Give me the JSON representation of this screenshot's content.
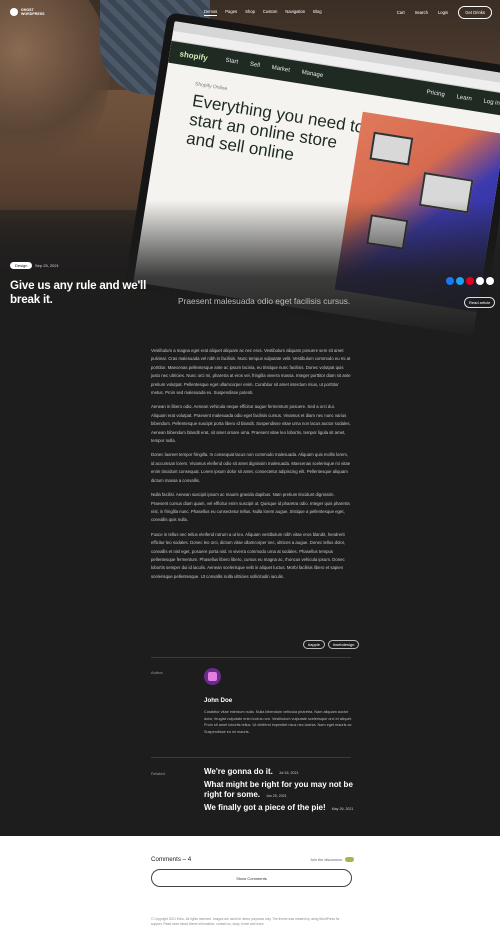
{
  "nav": {
    "logo_text": "GHOST WORDPRESS",
    "menu": [
      "Demos",
      "Pages",
      "Shop",
      "Custom",
      "Navigation",
      "Blog"
    ],
    "right": [
      "Cart",
      "Search",
      "Login"
    ],
    "cta": "Get Drinks"
  },
  "hero": {
    "category": "Design",
    "date": "Sep 25, 2021",
    "title": "Give us any rule and we'll break it.",
    "subtitle": "Praesent malesuada odio eget facilisis cursus.",
    "read_button": "Read article",
    "share_colors": [
      "#1877f2",
      "#1da1f2",
      "#e60023",
      "#ffffff",
      "#ffffff"
    ],
    "screen": {
      "logo": "shopify",
      "nav": [
        "Start",
        "Sell",
        "Market",
        "Manage"
      ],
      "nav_right": [
        "Pricing",
        "Learn",
        "Log in"
      ],
      "small": "Shopify Online",
      "headline": "Everything you need to start an online store and sell online"
    }
  },
  "article": {
    "paragraphs": [
      "Vestibulum a magna eget erat aliquet aliquam ac nec eros. Vestibulum aliquam posuere sem sit amet pulvinar. Cras malesuada vel nibh in facilisis. Nunc tempus vulputate velit. Vestibulum commodo eu mi at porttitor. Maecenas pellentesque ante ac ipsum lacinia, eu tristique nunc facilisis. Donec volutpat quis justo nec ultricies. Nunc orci mi, pharetra at eros vel, fringilla viverra massa. Integer porttitor diam sit ante pretium volutpat. Pellentesque eget ullamcorper enim. Curabitur sit amet interdum risus, ut porttitor metus. Proin sed malesuada ex. Suspendisse potenti.",
      "Aenean in libero odio. Aenean vehicula neque efficitur augue fermentum posuere. Sed a orci dui. Aliquam erat volutpat. Praesent malesuada odio eget facilisis cursus. Vivamus et diam nec nunc varius bibendum. Pellentesque suscipit porta libero id blandit. Suspendisse vitae urna non lacus auctor sodales. Aenean bibendum blandit erat, sit amet ornare urna. Praesent vitae leo lobortis, tempor ligula sit amet, tempor nulla.",
      "Donec laoreet tempor fringilla. In consequat lacus non commodo malesuada. Aliquam quis mollis lorem, id accumsan lorem. Vivamus eleifend odio sit amet dignissim malesuada. Maecenas scelerisque mi vitae enim tincidunt consequat. Lorem ipsum dolor sit amet, consectetur adipiscing elit. Pellentesque aliquam dictum massa a convallis.",
      "Nulla facilisi. Aenean suscipit ipsum ac mauris gravida dapibus. Nam pretium tincidunt dignissim. Praesent cursus diam quam, vel efficitur enim suscipit ut. Quisque id pharetra odio. Integer quis pharetra nisl, in fringilla nunc. Phasellus eu consectetur tellus. Nulla lorem augue, tristique a pellentesque eget, convallis quis nulla.",
      "Fusce in tellus nec tellus eleifend rutrum a ut leo. Aliquam vestibulum nibh vitae eros blandit, hendrerit efficitur leo sodales. Donec leo orci, dictum vitae ullamcorper nec, ultrices a augue. Donec tellus dolor, convallis et nisl eget, posuere porta nisl. In viverra commodo urna at sodales. Phasellus tempus pellentesque fermentum. Phasellus libero libero, cursus eu magna ac, rhoncus vehicula ipsum. Donec lobortis semper dui id iaculis. Aenean scelerisque velit in aliquet luctus. Morbi facilisis libero et sapien scelerisque pellentesque. Ut convallis nulla ultricies sollicitudin iaculis."
    ]
  },
  "tags": [
    "#apple",
    "#webdesign"
  ],
  "author": {
    "label": "Author",
    "name": "John Doe",
    "bio": "Curabitur vitae interdum nulla. Nulla bibendum vehicula pharetra. Nam aliquam auctor dolor, feugiat vulputate enim luctus non. Vestibulum vulputate scelerisque orci et aliquet. Proin sit amet lobortis tellus. Ut eleifend imperdiet risus nec lacinia. Nam eget mauris ac Suspendisse eu mi mauris."
  },
  "related": {
    "label": "Related",
    "items": [
      {
        "title": "We're gonna do it.",
        "date": "Jul 16, 2021"
      },
      {
        "title": "What might be right for you may not be right for some.",
        "date": "Jun 25, 2021"
      },
      {
        "title": "We finally got a piece of the pie!",
        "date": "May 26, 2021"
      }
    ]
  },
  "comments": {
    "title": "Comments – 4",
    "join": "Join the discussion",
    "button": "Show Comments",
    "footer": "© Copyright 2021 Echo. All rights reserved. Images are used for demo purposes only. The theme was created by using WordPress for support. Read more about theme information, contact us, shop, home and more."
  }
}
